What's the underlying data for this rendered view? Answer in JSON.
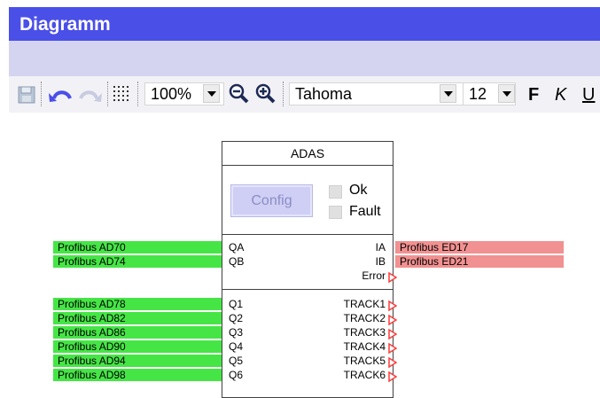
{
  "window": {
    "title": "Diagramm"
  },
  "toolbar": {
    "zoom": "100%",
    "font_name": "Tahoma",
    "font_size": "12",
    "bold_label": "F",
    "italic_label": "K",
    "underline_label": "U"
  },
  "block": {
    "title": "ADAS",
    "config_label": "Config",
    "ok_label": "Ok",
    "fault_label": "Fault",
    "input_ports": [
      "QA",
      "QB",
      "Q1",
      "Q2",
      "Q3",
      "Q4",
      "Q5",
      "Q6"
    ],
    "output_ports": [
      "IA",
      "IB",
      "Error",
      "TRACK1",
      "TRACK2",
      "TRACK3",
      "TRACK4",
      "TRACK5",
      "TRACK6"
    ]
  },
  "signals_in": [
    "Profibus AD70",
    "Profibus AD74",
    "Profibus AD78",
    "Profibus AD82",
    "Profibus AD86",
    "Profibus AD90",
    "Profibus AD94",
    "Profibus AD98"
  ],
  "signals_out": [
    "Profibus ED17",
    "Profibus ED21"
  ],
  "colors": {
    "title_bar": "#4a4fe8",
    "input_signal": "#46e546",
    "output_signal": "#f29191",
    "port_arrow": "#ff3b3b"
  }
}
